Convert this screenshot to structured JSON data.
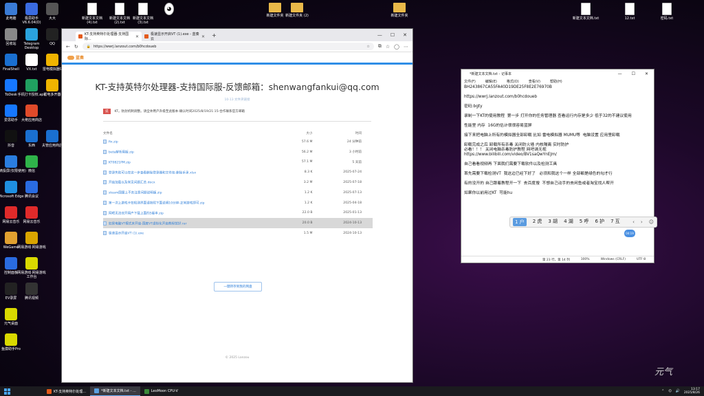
{
  "desktop": {
    "left_icons": [
      [
        "此电脑",
        "#3a7bd5"
      ],
      [
        "极思助手 V6.6.04(D)",
        "#3a6be0"
      ],
      [
        "大大",
        "#555"
      ],
      [
        "回收站",
        "#888"
      ],
      [
        "Telegram Desktop",
        "#2aa3de"
      ],
      [
        "QQ",
        "#222"
      ],
      [
        "FinalShell",
        "#1a6fd0"
      ],
      [
        "VX.txt",
        "#fff"
      ],
      [
        "雷电模拟器9",
        "#f0b400"
      ],
      [
        "ToDesk",
        "#1677ff"
      ],
      [
        "手机打卡授权.apk",
        "#20a060"
      ],
      [
        "雷电多开器",
        "#f0b400"
      ],
      [
        "爱思助手",
        "#1677ff"
      ],
      [
        "大佬应用商店",
        "#e04a2a"
      ],
      [
        "",
        ""
      ],
      [
        "抖音",
        "#111"
      ],
      [
        "东西",
        "#1a6fd0"
      ],
      [
        "夫管应用商店",
        "#1a6fd0"
      ],
      [
        "水滴投屏(仅限使用)",
        "#2a7de0"
      ],
      [
        "微信",
        "#2fb34a"
      ],
      [
        "",
        ""
      ],
      [
        "Microsoft Edge",
        "#1f8fe0"
      ],
      [
        "腾讯会议",
        "#2a6be0"
      ],
      [
        "",
        ""
      ],
      [
        "网易云音乐",
        "#e02a2a"
      ],
      [
        "网易云音乐",
        "#e02a2a"
      ],
      [
        "",
        ""
      ],
      [
        "WeGame",
        "#e0a030"
      ],
      [
        "网易游戏·网易游戏",
        "#d9a400"
      ],
      [
        "",
        ""
      ],
      [
        "控制面板",
        "#2a6be0"
      ],
      [
        "网易游戏·网易游戏工作台",
        "#d9d900"
      ],
      [
        "",
        ""
      ],
      [
        "EV录屏",
        "#222"
      ],
      [
        "腾讯视频",
        "#333"
      ],
      [
        "",
        ""
      ],
      [
        "元气桌面",
        "#d9d900"
      ],
      [
        "",
        ""
      ],
      [
        "",
        ""
      ],
      [
        "鱼摸助手Pro",
        "#d9d900"
      ],
      [
        "",
        ""
      ],
      [
        "",
        ""
      ]
    ],
    "top_files": [
      {
        "label": "新建文本文档 (4).txt",
        "kind": "file"
      },
      {
        "label": "新建文本文档 (2).txt",
        "kind": "file"
      },
      {
        "label": "新建文本文档 (3).txt",
        "kind": "file"
      },
      {
        "label": "",
        "kind": "cat"
      },
      {
        "label": "新建文件夹",
        "kind": "folder"
      },
      {
        "label": "新建文件夹 (2)",
        "kind": "folder"
      },
      {
        "label": "新建文件夹",
        "kind": "folder"
      },
      {
        "label": "新建文本文档.txt",
        "kind": "file"
      },
      {
        "label": "12.txt",
        "kind": "file"
      },
      {
        "label": "密码.txt",
        "kind": "file"
      }
    ]
  },
  "browser": {
    "tabs": [
      {
        "label": "KT-支持英特尔处理器-支持国际...",
        "active": true
      },
      {
        "label": "极速显示开启VT (1).exe - 蓝奏云",
        "active": false
      }
    ],
    "new_tab": "+",
    "url": "https://wwrj.lanzout.com/b0hcdoueb",
    "site_logo": "蓝奏",
    "page_title": "KT-支持英特尔处理器-支持国际服-反馈邮箱：shenwangfankui@qq.com",
    "meta_date": "10-13",
    "meta_sep": "  ",
    "meta_type": "文件夹链接",
    "notice_badge": "说",
    "notice_text": "KT。防封机制调整。请全体用户升级至此版本-确认时间2025/8/19/21:15-合作联系官方邮箱",
    "headers": {
      "name": "文件名",
      "size": "大小",
      "time": "时间"
    },
    "files": [
      {
        "name": "fix.zip",
        "size": "57.6 M",
        "time": "24 分钟前"
      },
      {
        "name": "beta解析用版.zip",
        "size": "56.2 M",
        "time": "3 小时前"
      },
      {
        "name": "KT0821PM.zip",
        "size": "57.1 M",
        "time": "5 天前"
      },
      {
        "name": "登录失败可以在这一步查看删除登录器和文件包-删除手承.xlsx",
        "size": "8.3 K",
        "time": "2025-07-24"
      },
      {
        "name": "开启加载以及常见问题汇总.docx",
        "size": "3.2 M",
        "time": "2025-07-18"
      },
      {
        "name": "steam国服上不去注意问题说明版.zip",
        "size": "1.2 K",
        "time": "2025-07-13"
      },
      {
        "name": "第一次上游戏卡在检测界面请按照下面说明10分钟-正常游戏即可.zip",
        "size": "1.2 K",
        "time": "2025-04-18"
      },
      {
        "name": "网吧无法双开用户下载上面的5版本.zip",
        "size": "22.0 B",
        "time": "2025-01-13"
      },
      {
        "name": "如果电脑VT模式未开启-国度VT虚拟化开启教程就好.rar",
        "size": "20.0 B",
        "time": "2024-10-13",
        "highlight": true
      },
      {
        "name": "极速显示开启VT (1).exe",
        "size": "1.5 M",
        "time": "2024-10-13"
      }
    ],
    "more_button": "一键转存到我的网盘",
    "footer": "© 2025 Lanzou"
  },
  "notepad": {
    "title": "*新建文本文档.txt - 记事本",
    "controls": [
      "—",
      "☐",
      "✕"
    ],
    "menu": [
      "文件(F)",
      "编辑(E)",
      "格式(O)",
      "查看(V)",
      "帮助(H)"
    ],
    "lines": [
      "BH243867CA55FA40D19DE25F8E2E76970B",
      "https://wwrj.lanzout.com/b0hcdoueb",
      "密码:bgty",
      "录制一下KT的使用教程  第一步 打开你的任务管理器 查看运行内存是多少 低于32的不建议使用",
      "性能里 内存  16G的估计很很容易蓝屏",
      "接下来把电脑上所有的模拟器全部卸载 比如 雷电模拟器 MUMU等  电脑设置 应用里卸载",
      "卸载完成之后 卸载所有杀毒 关闭防火墙 内核隔离 实时防护\n必看！！！ 关闭电脑杀毒防护教程 网吧请无视\nhttps://www.bilibili.com/video/BV1saQwYnEJm/",
      "自己看看视频再 下面我们需要下载软件以及检测工具",
      "首先需要下载检测VT  我这边已经下好了   必须和我这个一样 全部都是绿色的勾才行",
      "有的没开的 自己跟着教程开一下  去百度搜  不想自己动手的去闲鱼或者淘宝找人帮开",
      "如果你以前用过KT  可能hu"
    ],
    "status": [
      "第 23 行，第 14 列",
      "100%",
      "Windows (CRLF)",
      "UTF-8"
    ]
  },
  "ime": {
    "candidates": [
      "1 户",
      "2 虎",
      "3 胡",
      "4 湖",
      "5 呼",
      "6 护",
      "7 互"
    ],
    "prev": "‹",
    "next": "›",
    "badge": "04:19"
  },
  "taskbar": {
    "items": [
      {
        "label": "KT-支持英特尔处理...",
        "color": "#e35a1a",
        "active": false
      },
      {
        "label": "*新建文本文档.txt - ...",
        "color": "#5aa0e0",
        "active": true
      },
      {
        "label": "LeoMoon CPU-V",
        "color": "#3a8a3a",
        "active": false
      }
    ],
    "time": "13:17",
    "date": "2025/8/26"
  },
  "signature": "元气"
}
